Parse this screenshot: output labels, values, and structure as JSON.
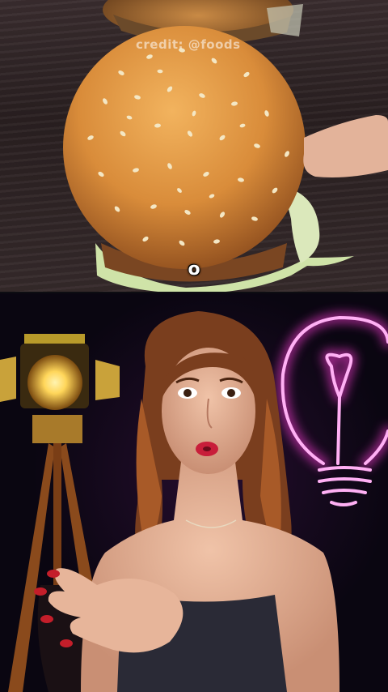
{
  "video_top": {
    "watermark": "credit: @foods",
    "caption_letter": "o"
  },
  "video_bottom": {},
  "colors": {
    "bun": "#d98c3a",
    "bun_highlight": "#f2b35e",
    "neon_pink": "#ff3cd8",
    "lamp_glow": "#ffd65a",
    "background_dark": "#0a0611"
  }
}
